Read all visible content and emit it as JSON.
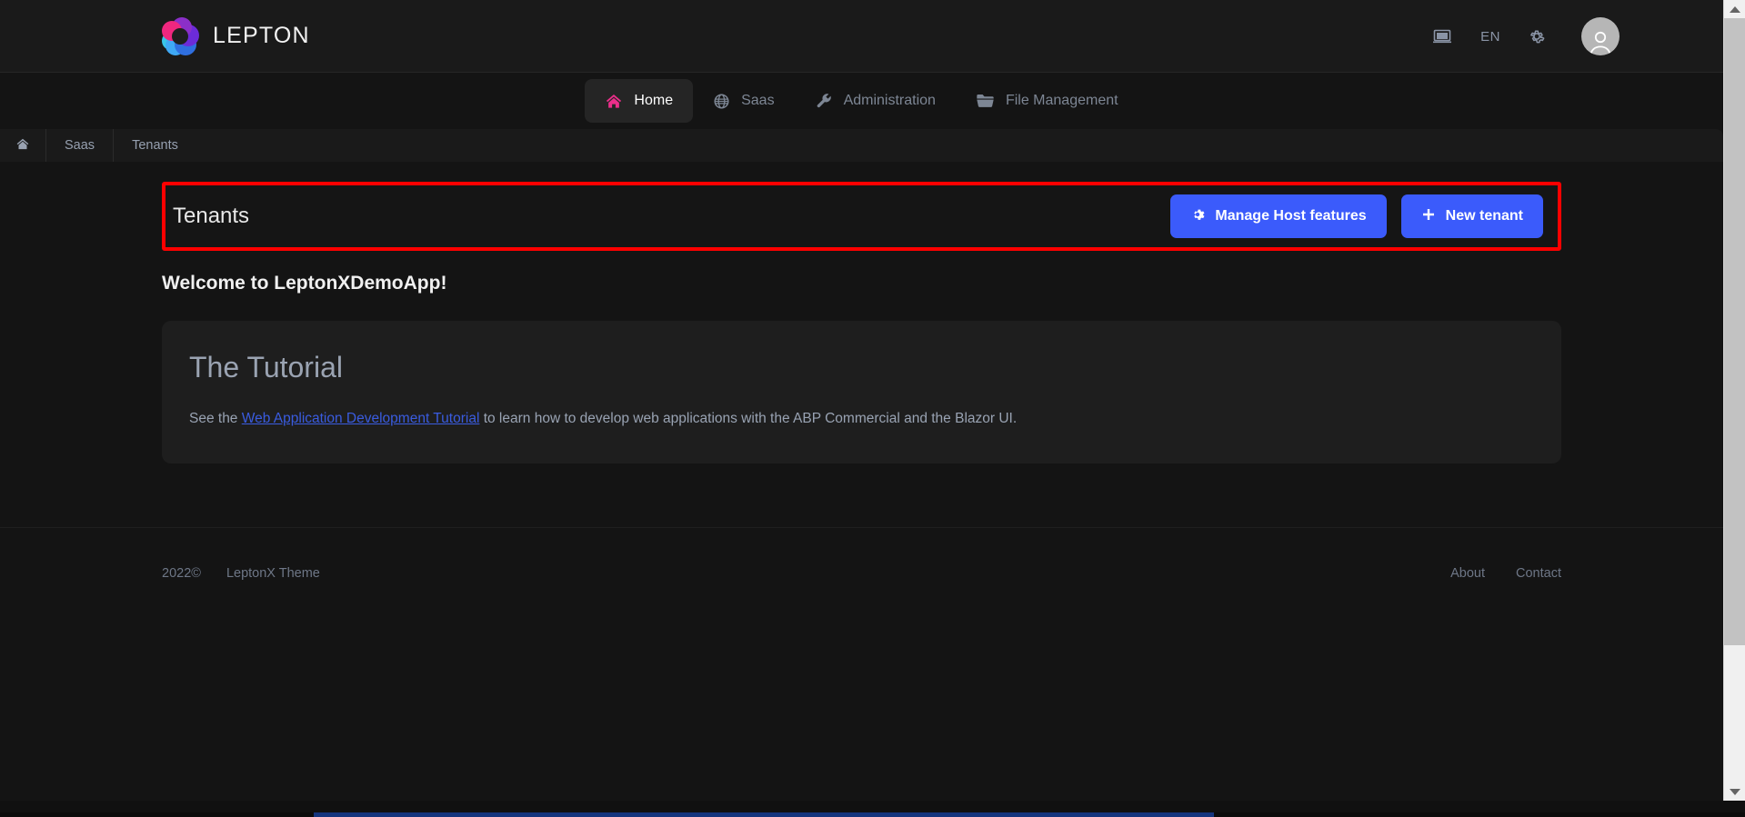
{
  "brand": {
    "name": "LEPTON",
    "logo_icon": "lepton-logo-icon"
  },
  "header": {
    "screen_icon": "monitor-icon",
    "language": "EN",
    "settings_icon": "gear-icon",
    "avatar_icon": "user-avatar-icon"
  },
  "mainnav": {
    "items": [
      {
        "label": "Home",
        "icon": "home-icon",
        "active": true
      },
      {
        "label": "Saas",
        "icon": "globe-icon",
        "active": false
      },
      {
        "label": "Administration",
        "icon": "wrench-icon",
        "active": false
      },
      {
        "label": "File Management",
        "icon": "folder-icon",
        "active": false
      }
    ]
  },
  "breadcrumb": {
    "home_icon": "home-icon",
    "items": [
      {
        "label": "Saas"
      },
      {
        "label": "Tenants"
      }
    ]
  },
  "page": {
    "title": "Tenants",
    "highlight_color": "#ff0000",
    "actions": [
      {
        "label": "Manage Host features",
        "icon": "gear-icon",
        "color": "#3b5bfb"
      },
      {
        "label": "New tenant",
        "icon": "plus-icon",
        "color": "#3b5bfb"
      }
    ]
  },
  "welcome": {
    "heading": "Welcome to LeptonXDemoApp!"
  },
  "tutorial_card": {
    "title": "The Tutorial",
    "text_before": "See the ",
    "link_text": "Web Application Development Tutorial",
    "text_after": " to learn how to develop web applications with the ABP Commercial and the Blazor UI.",
    "link_color": "#3a5ce0"
  },
  "footer": {
    "copyright": "2022©",
    "theme_name": "LeptonX Theme",
    "links": [
      {
        "label": "About"
      },
      {
        "label": "Contact"
      }
    ]
  },
  "scrollbar": {
    "up_icon": "scroll-up-arrow-icon",
    "down_icon": "scroll-down-arrow-icon"
  }
}
